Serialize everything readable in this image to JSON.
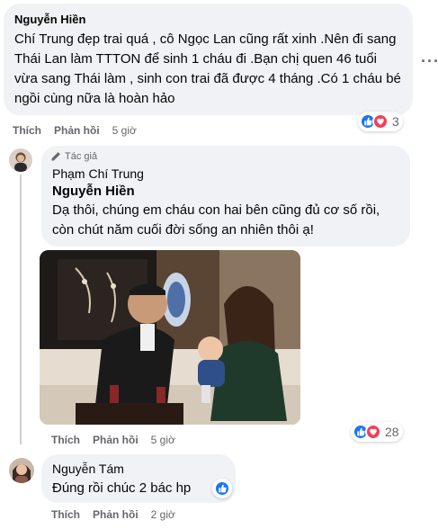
{
  "comments": [
    {
      "author": "Nguyễn Hiền",
      "text": "Chí Trung đẹp trai quá , cô Ngọc Lan cũng rất xinh .Nên đi sang Thái Lan làm TTTON để sinh 1 cháu đi .Bạn chị quen 46 tuổi vừa sang Thái làm , sinh con trai đã được 4 tháng .Có 1 cháu bé ngồi cùng nữa là hoàn hảo",
      "like_label": "Thích",
      "reply_label": "Phản hồi",
      "time": "5 giờ",
      "reaction_count": "3"
    },
    {
      "badge": "Tác giả",
      "author": "Phạm Chí Trung",
      "mention": "Nguyễn Hiền",
      "text": "Dạ thôi, chúng em cháu con hai bên cũng đủ cơ số rồi, còn chút năm cuối đời sống an nhiên thôi ạ!",
      "like_label": "Thích",
      "reply_label": "Phản hồi",
      "time": "5 giờ",
      "reaction_count": "28"
    },
    {
      "author": "Nguyễn Tám",
      "text": "Đúng rồi chúc 2 bác hp",
      "like_label": "Thích",
      "reply_label": "Phản hồi",
      "time": "2 giờ"
    }
  ],
  "colors": {
    "bubble": "#f0f2f5",
    "like_blue": "#1877f2",
    "love_red": "#f33e58",
    "meta_gray": "#65676b"
  },
  "icons": [
    "pencil-icon",
    "like-icon",
    "love-icon",
    "more-icon"
  ]
}
